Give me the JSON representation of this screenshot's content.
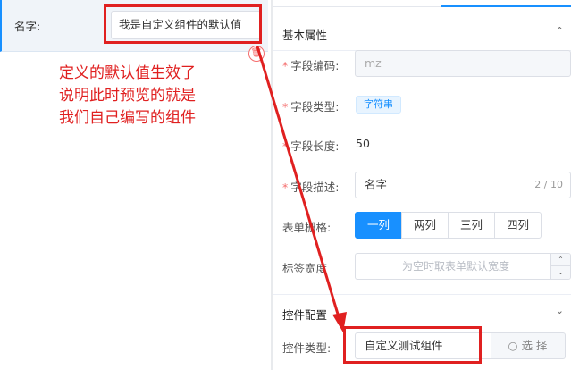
{
  "preview": {
    "field_label": "名字:",
    "field_value": "我是自定义组件的默认值",
    "delete_icon_glyph": "🗑"
  },
  "annotation": {
    "lines": [
      "定义的默认值生效了",
      "说明此时预览的就是",
      "我们自己编写的组件"
    ],
    "color": "#e02020"
  },
  "props": {
    "basic_section": {
      "title": "基本属性",
      "chevron": "⌃"
    },
    "field_code": {
      "label": "字段编码:",
      "value": "mz",
      "required": true
    },
    "field_type": {
      "label": "字段类型:",
      "value": "字符串",
      "required": true
    },
    "field_length": {
      "label": "字段长度:",
      "value": "50",
      "required": true
    },
    "field_desc": {
      "label": "字段描述:",
      "value": "名字",
      "counter": "2 / 10",
      "required": true
    },
    "form_grid": {
      "label": "表单栅格:",
      "options": [
        "一列",
        "两列",
        "三列",
        "四列"
      ],
      "selected": "一列"
    },
    "label_width": {
      "label": "标签宽度",
      "placeholder": "为空时取表单默认宽度",
      "up": "⌃",
      "down": "⌄"
    },
    "control_section": {
      "title": "控件配置",
      "chevron": "⌄"
    },
    "control_type": {
      "label": "控件类型:",
      "value": "自定义测试组件",
      "select_label": "选 择",
      "select_icon": "○"
    },
    "required_mark": "*"
  },
  "colors": {
    "accent": "#1890ff",
    "highlight": "#e02020",
    "required": "#f56c6c"
  }
}
